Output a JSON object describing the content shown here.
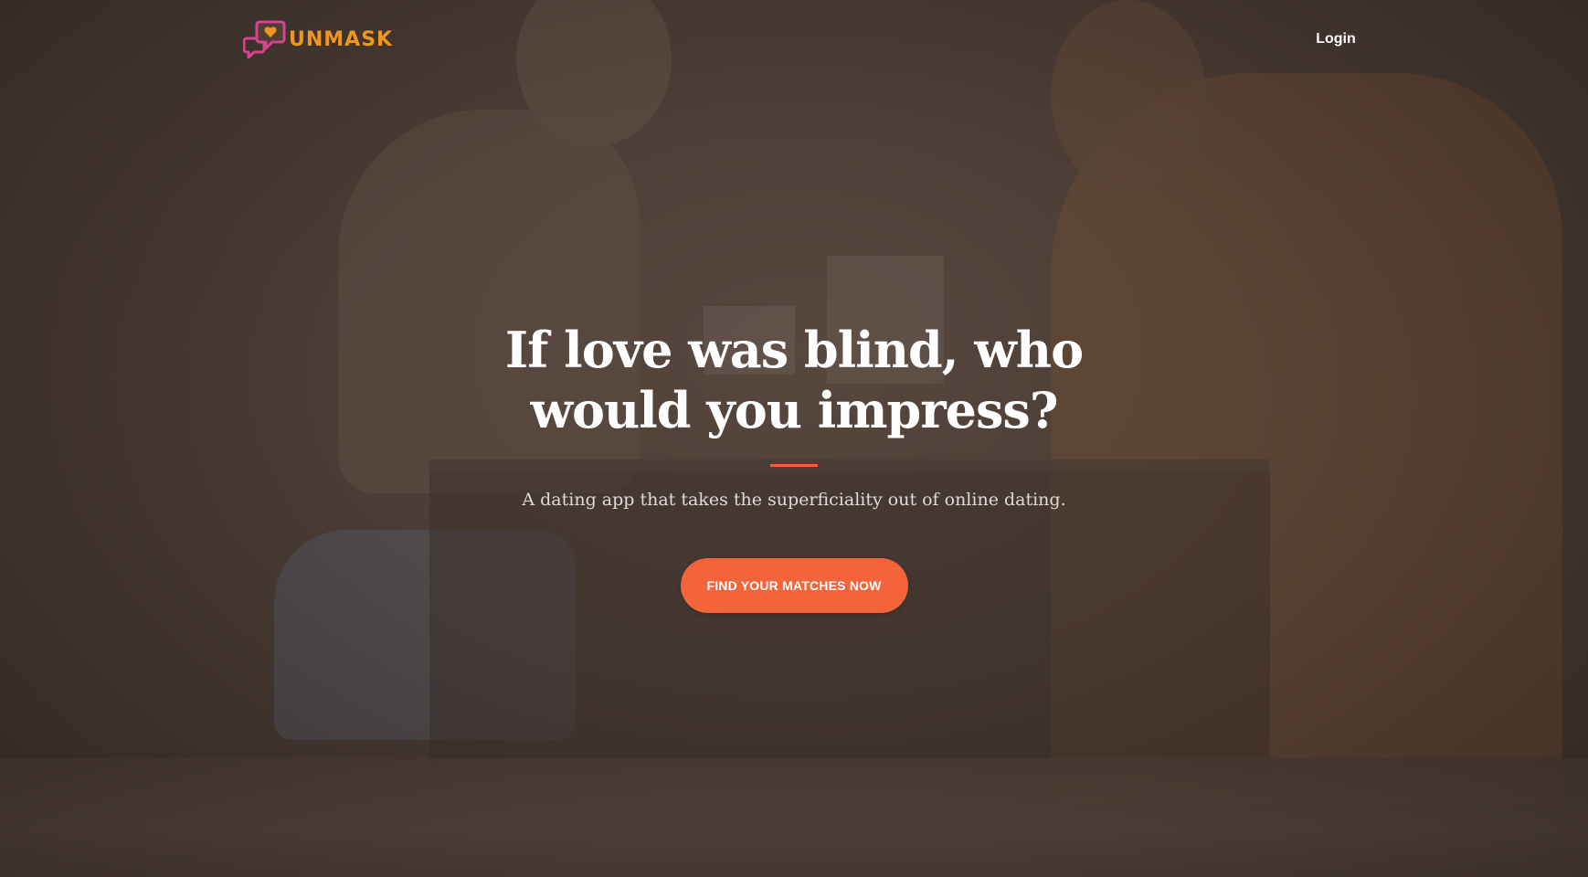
{
  "brand": {
    "name": "UNMASK",
    "logo_icon": "chat-bubbles-heart-icon",
    "colors": {
      "logo_text": "#f0961e",
      "logo_bubble": "#d8428f",
      "logo_heart": "#f0961e"
    }
  },
  "nav": {
    "login_label": "Login"
  },
  "hero": {
    "headline": "If love was blind, who would you impress?",
    "subtitle": "A dating app that takes the superficiality out of online dating.",
    "cta_label": "FIND YOUR MATCHES NOW"
  },
  "theme": {
    "accent": "#f4643a",
    "text": "#ffffff"
  }
}
